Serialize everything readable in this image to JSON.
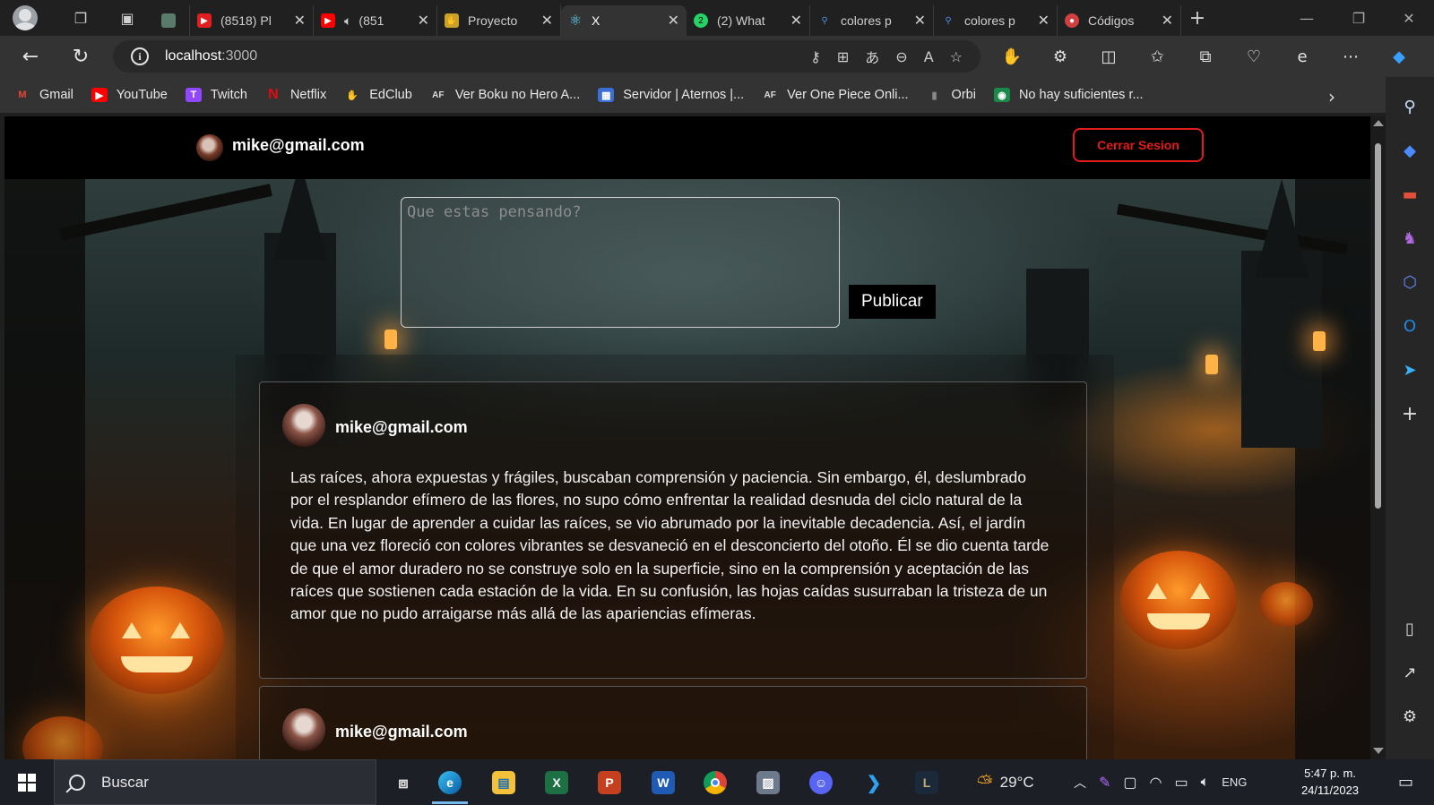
{
  "browser": {
    "tabs": [
      {
        "title": "",
        "favicon": "generic-page-icon",
        "color": "#5a7a6a"
      },
      {
        "title": "(8518) Pl",
        "favicon": "youtube-icon",
        "color": "#e02020"
      },
      {
        "title": "(851",
        "favicon": "youtube-icon",
        "color": "#ff0000"
      },
      {
        "title": "Proyecto",
        "favicon": "hand-icon",
        "color": "#c9a227"
      },
      {
        "title": "X",
        "favicon": "react-icon",
        "color": "#61dafb",
        "active": true
      },
      {
        "title": "(2) What",
        "favicon": "whatsapp-icon",
        "color": "#25d366",
        "badge": "2"
      },
      {
        "title": "colores p",
        "favicon": "search-icon",
        "color": "#4a90e2"
      },
      {
        "title": "colores p",
        "favicon": "search-icon",
        "color": "#4a90e2"
      },
      {
        "title": "Códigos",
        "favicon": "record-icon",
        "color": "#d04040"
      }
    ],
    "url": {
      "host": "localhost",
      "port": ":3000"
    },
    "bookmarks": [
      {
        "label": "Gmail",
        "icon": "gmail-icon",
        "color": "#ea4335",
        "glyph": "M"
      },
      {
        "label": "YouTube",
        "icon": "youtube-icon",
        "color": "#ff0000",
        "glyph": "▶"
      },
      {
        "label": "Twitch",
        "icon": "twitch-icon",
        "color": "#9146ff",
        "glyph": "T"
      },
      {
        "label": "Netflix",
        "icon": "netflix-icon",
        "color": "#e50914",
        "glyph": "N"
      },
      {
        "label": "EdClub",
        "icon": "edclub-icon",
        "color": "#f6a531",
        "glyph": "✋"
      },
      {
        "label": "Ver Boku no Hero A...",
        "icon": "animeflv-icon",
        "color": "#333333",
        "glyph": "AF"
      },
      {
        "label": "Servidor | Aternos |...",
        "icon": "aternos-icon",
        "color": "#3b6fd6",
        "glyph": "▦"
      },
      {
        "label": "Ver One Piece Onli...",
        "icon": "animeflv-icon",
        "color": "#333333",
        "glyph": "AF"
      },
      {
        "label": "Orbi",
        "icon": "orbi-icon",
        "color": "#555555",
        "glyph": "▮"
      },
      {
        "label": "No hay suficientes r...",
        "icon": "page-icon",
        "color": "#1a8a4a",
        "glyph": "◉"
      }
    ]
  },
  "app": {
    "header_user": "mike@gmail.com",
    "logout_label": "Cerrar Sesion",
    "composer_placeholder": "Que estas pensando?",
    "publish_label": "Publicar",
    "posts": [
      {
        "user": "mike@gmail.com",
        "body": "Las raíces, ahora expuestas y frágiles, buscaban comprensión y paciencia. Sin embargo, él, deslumbrado por el resplandor efímero de las flores, no supo cómo enfrentar la realidad desnuda del ciclo natural de la vida. En lugar de aprender a cuidar las raíces, se vio abrumado por la inevitable decadencia. Así, el jardín que una vez floreció con colores vibrantes se desvaneció en el desconcierto del otoño. Él se dio cuenta tarde de que el amor duradero no se construye solo en la superficie, sino en la comprensión y aceptación de las raíces que sostienen cada estación de la vida. En su confusión, las hojas caídas susurraban la tristeza de un amor que no pudo arraigarse más allá de las apariencias efímeras."
      },
      {
        "user": "mike@gmail.com",
        "body": ""
      }
    ],
    "accent_color": "#e21b1b"
  },
  "taskbar": {
    "search_label": "Buscar",
    "weather": "29°C",
    "language": "ENG",
    "time": "5:47 p. m.",
    "date": "24/11/2023"
  }
}
